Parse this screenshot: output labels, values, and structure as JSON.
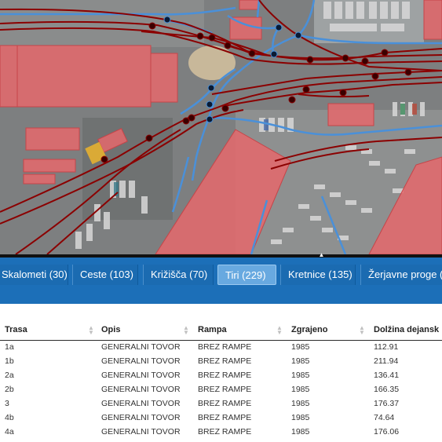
{
  "tabs": [
    {
      "label": "Skalometi (30)",
      "active": false
    },
    {
      "label": "Ceste (103)",
      "active": false
    },
    {
      "label": "Križišča (70)",
      "active": false
    },
    {
      "label": "Tiri (229)",
      "active": true
    },
    {
      "label": "Kretnice (135)",
      "active": false
    },
    {
      "label": "Žerjavne proge (",
      "active": false
    }
  ],
  "table": {
    "headers": [
      "Trasa",
      "Opis",
      "Rampa",
      "Zgrajeno",
      "Dolžina dejansk"
    ],
    "rows": [
      [
        "1a",
        "GENERALNI TOVOR",
        "BREZ RAMPE",
        "1985",
        "112.91"
      ],
      [
        "1b",
        "GENERALNI TOVOR",
        "BREZ RAMPE",
        "1985",
        "211.94"
      ],
      [
        "2a",
        "GENERALNI TOVOR",
        "BREZ RAMPE",
        "1985",
        "136.41"
      ],
      [
        "2b",
        "GENERALNI TOVOR",
        "BREZ RAMPE",
        "1985",
        "166.35"
      ],
      [
        "3",
        "GENERALNI TOVOR",
        "BREZ RAMPE",
        "1985",
        "176.37"
      ],
      [
        "4b",
        "GENERALNI TOVOR",
        "BREZ RAMPE",
        "1985",
        "74.64"
      ],
      [
        "4a",
        "GENERALNI TOVOR",
        "BREZ RAMPE",
        "1985",
        "176.06"
      ]
    ]
  },
  "colors": {
    "tab_bar": "#1c6fb8",
    "active_tab": "#68a9e0",
    "building_fill": "#e5686c",
    "track_line": "#8b0000",
    "road_line": "#4a90d9"
  }
}
